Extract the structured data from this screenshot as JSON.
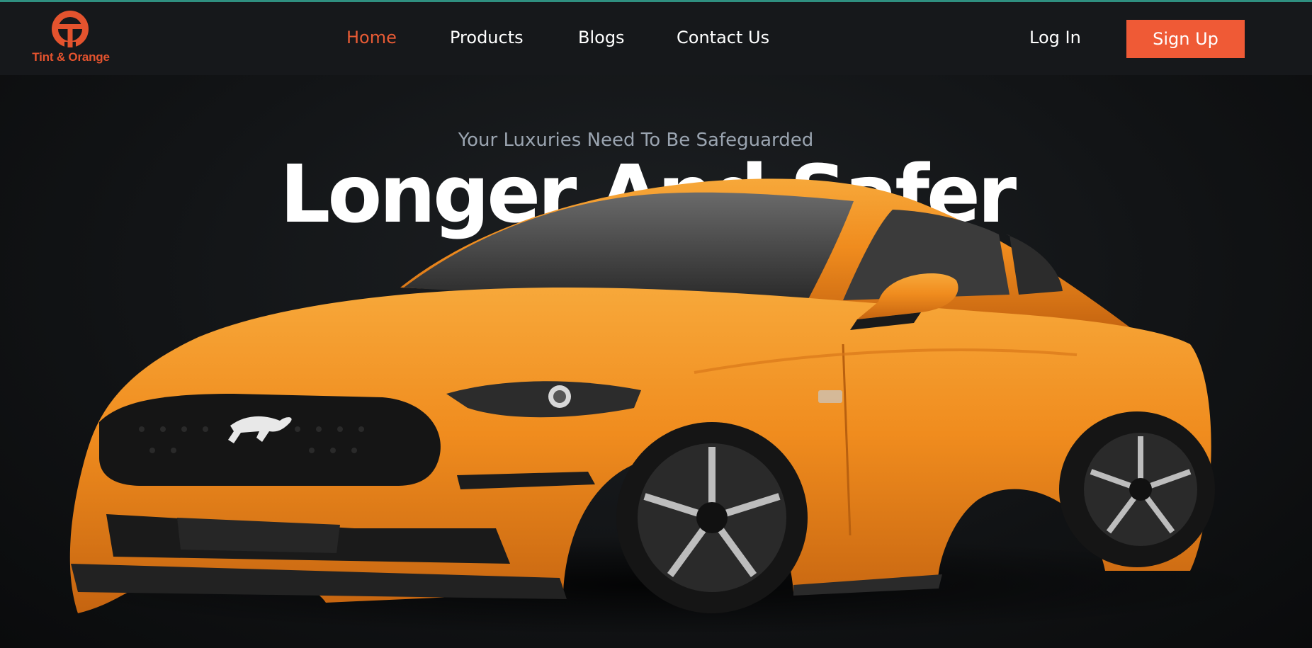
{
  "brand": {
    "name": "Tint & Orange",
    "color": "#e4532e"
  },
  "nav": {
    "links": [
      {
        "label": "Home",
        "active": true
      },
      {
        "label": "Products",
        "active": false
      },
      {
        "label": "Blogs",
        "active": false
      },
      {
        "label": "Contact Us",
        "active": false
      }
    ],
    "login_label": "Log In",
    "signup_label": "Sign Up"
  },
  "hero": {
    "tagline": "Your Luxuries Need To Be Safeguarded",
    "headline": "Longer And Safer",
    "car_color": "#f08c1e"
  },
  "colors": {
    "accent": "#ef5a36",
    "navbar_bg": "#16181b",
    "top_line": "#2f8f80"
  }
}
